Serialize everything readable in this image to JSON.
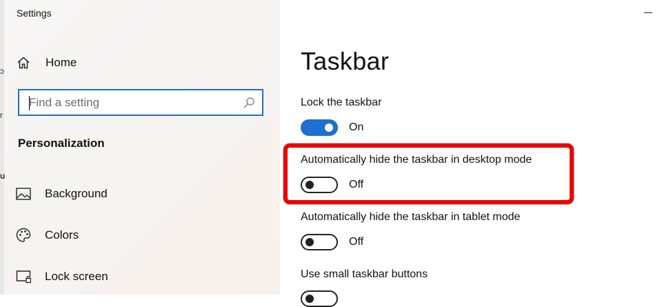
{
  "window": {
    "title": "Settings"
  },
  "sidebar": {
    "home_label": "Home",
    "search": {
      "placeholder": "Find a setting"
    },
    "section_title": "Personalization",
    "items": [
      {
        "label": "Background",
        "icon": "image-icon"
      },
      {
        "label": "Colors",
        "icon": "palette-icon"
      },
      {
        "label": "Lock screen",
        "icon": "lock-screen-icon"
      }
    ]
  },
  "main": {
    "title": "Taskbar",
    "settings": [
      {
        "label": "Lock the taskbar",
        "state": "On",
        "on": true
      },
      {
        "label": "Automatically hide the taskbar in desktop mode",
        "state": "Off",
        "on": false
      },
      {
        "label": "Automatically hide the taskbar in tablet mode",
        "state": "Off",
        "on": false
      },
      {
        "label": "Use small taskbar buttons"
      }
    ]
  },
  "colors": {
    "accent": "#1f6fd0",
    "highlight": "#ee0000"
  }
}
